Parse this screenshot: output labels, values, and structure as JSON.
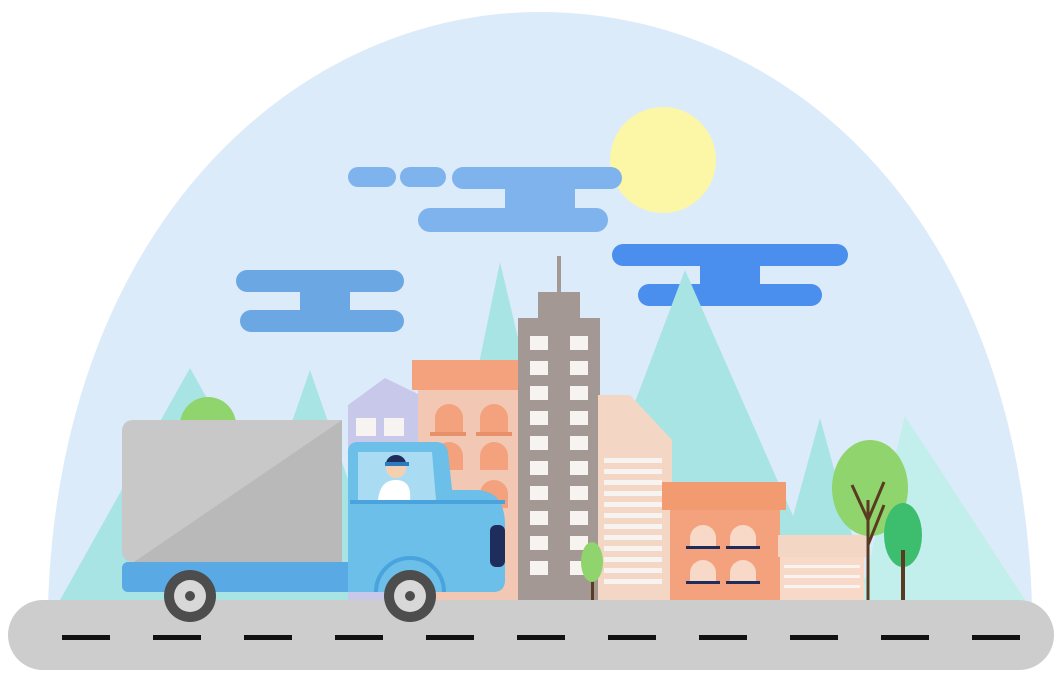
{
  "colors": {
    "background": "#ffffff",
    "sky": "#dcebf9",
    "sun": "#fbf7a6",
    "cloud_light": "#7fb3ee",
    "cloud_dark": "#4b8fee",
    "mountain": "#a8e4e3",
    "mountain_shade": "#c2eeec",
    "road": "#cdcdcd",
    "road_dash": "#111111",
    "truck_cab": "#6bbfe8",
    "truck_cargo": "#c8c8c8",
    "truck_cargo_shade": "#b9b9b9",
    "truck_bed": "#58a9e4",
    "tree_green": "#8fd46c",
    "tree_dark": "#3dbd6e",
    "building_grey": "#a39894",
    "building_orange": "#f3a27d",
    "building_peach": "#f2c7b3",
    "building_lavender": "#c8c9ea",
    "building_beige": "#f4d6c4"
  },
  "scene": {
    "description_icons": [
      "sun-icon",
      "cloud-icon",
      "mountain-icon",
      "building-icon",
      "tree-icon",
      "truck-icon",
      "driver-icon",
      "road-icon"
    ]
  }
}
